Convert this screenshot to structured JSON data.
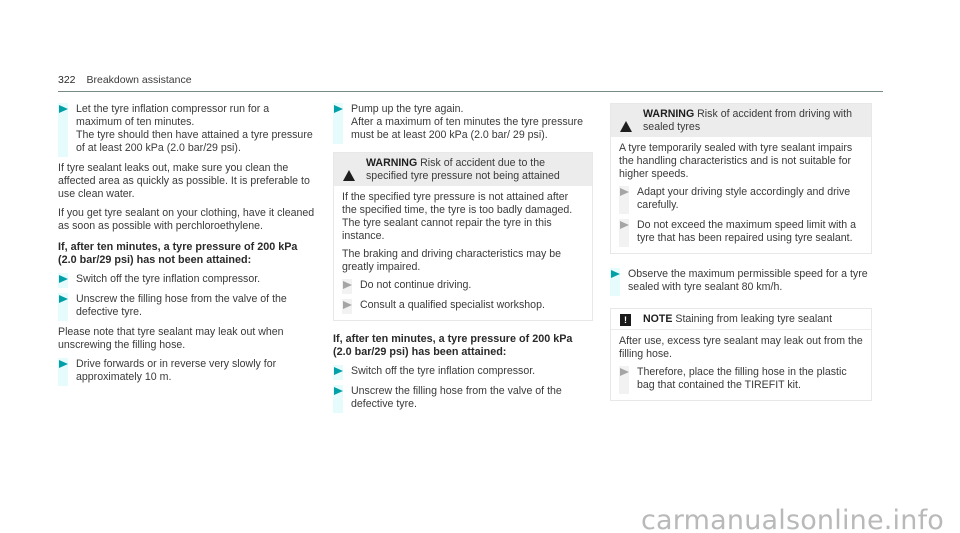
{
  "header": {
    "page_number": "322",
    "section": "Breakdown assistance"
  },
  "column1": {
    "step1": {
      "line1": "Let the tyre inflation compressor run for a maximum of ten minutes.",
      "line2": "The tyre should then have attained a tyre pressure of at least 200 kPa (2.0 bar/29 psi)."
    },
    "para1": "If tyre sealant leaks out, make sure you clean the affected area as quickly as possible. It is preferable to use clean water.",
    "para2": "If you get tyre sealant on your clothing, have it cleaned as soon as possible with perchloroethylene.",
    "subheading": "If, after ten minutes, a tyre pressure of 200 kPa (2.0 bar/29 psi) has not been attained:",
    "step2": "Switch off the tyre inflation compressor.",
    "step3": "Unscrew the filling hose from the valve of the defective tyre.",
    "para3": "Please note that tyre sealant may leak out when unscrewing the filling hose.",
    "step4": "Drive forwards or in reverse very slowly for approximately 10 m."
  },
  "column2": {
    "step1": {
      "line1": "Pump up the tyre again.",
      "line2": "After a maximum of ten minutes the tyre pressure must be at least 200 kPa (2.0 bar/ 29 psi)."
    },
    "warning": {
      "label": "WARNING",
      "title": "Risk of accident due to the specified tyre pressure not being attained",
      "para1": "If the specified tyre pressure is not attained after the specified time, the tyre is too badly damaged. The tyre sealant cannot repair the tyre in this instance.",
      "para2": "The braking and driving characteristics may be greatly impaired.",
      "steps": [
        "Do not continue driving.",
        "Consult a qualified specialist workshop."
      ]
    },
    "subheading": "If, after ten minutes, a tyre pressure of 200 kPa (2.0 bar/29 psi) has been attained:",
    "step2": "Switch off the tyre inflation compressor.",
    "step3": "Unscrew the filling hose from the valve of the defective tyre."
  },
  "column3": {
    "warning": {
      "label": "WARNING",
      "title": "Risk of accident from driving with sealed tyres",
      "para1": "A tyre temporarily sealed with tyre sealant impairs the handling characteristics and is not suitable for higher speeds.",
      "steps": [
        "Adapt your driving style accordingly and drive carefully.",
        "Do not exceed the maximum speed limit with a tyre that has been repaired using tyre sealant."
      ]
    },
    "step1": "Observe the maximum permissible speed for a tyre sealed with tyre sealant 80 km/h.",
    "note": {
      "icon_glyph": "!",
      "label": "NOTE",
      "title": "Staining from leaking tyre sealant",
      "para1": "After use, excess tyre sealant may leak out from the filling hose.",
      "steps": [
        "Therefore, place the filling hose in the plastic bag that contained the TIREFIT kit."
      ]
    }
  },
  "watermark": "carmanualsonline.info",
  "colors": {
    "accent_arrow": "#00a0a8",
    "step_bar": "#e6fbfb",
    "warning_header_bg": "#ececec",
    "rule": "#7a8a86"
  }
}
